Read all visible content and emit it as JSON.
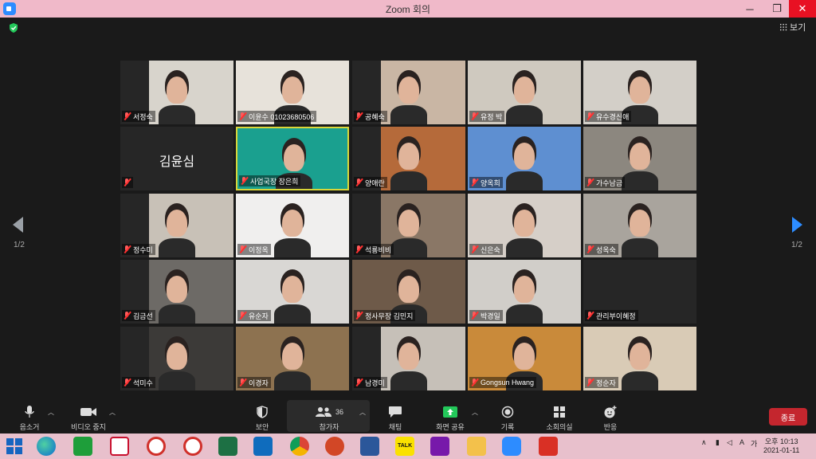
{
  "window": {
    "title": "Zoom 회의",
    "minimize": "─",
    "maximize": "❐",
    "close": "✕"
  },
  "view_button": {
    "label": "보기"
  },
  "pagination": {
    "left": "1/2",
    "right": "1/2"
  },
  "participants": [
    {
      "name": "서정숙",
      "bg": "#d8d4cc"
    },
    {
      "name": "이윤수 01023680506",
      "bg": "#e7e2da"
    },
    {
      "name": "공혜숙",
      "bg": "#c9b6a4"
    },
    {
      "name": "유정 박",
      "bg": "#cfc9bf"
    },
    {
      "name": "유수경신애",
      "bg": "#d3cfc8"
    },
    {
      "name": "김윤심",
      "bg": "#262626"
    },
    {
      "name": "사업국장 장은희",
      "bg": "#1aa08f"
    },
    {
      "name": "양애란",
      "bg": "#b56a3a"
    },
    {
      "name": "양옥희",
      "bg": "#5e8fd1"
    },
    {
      "name": "가수남금",
      "bg": "#8c877f"
    },
    {
      "name": "정수미",
      "bg": "#c8c1b7"
    },
    {
      "name": "이정옥",
      "bg": "#f0efee"
    },
    {
      "name": "석룡비비",
      "bg": "#8a7766"
    },
    {
      "name": "신은숙",
      "bg": "#d6cfc8"
    },
    {
      "name": "성옥숙",
      "bg": "#a9a49d"
    },
    {
      "name": "김금선",
      "bg": "#6d6a66"
    },
    {
      "name": "유순자",
      "bg": "#d9d7d4"
    },
    {
      "name": "정사무장 김민지",
      "bg": "#6e5a49"
    },
    {
      "name": "박경일",
      "bg": "#d1cec9"
    },
    {
      "name": "관리부이혜정",
      "bg": "#262626"
    },
    {
      "name": "석미수",
      "bg": "#3c3a38"
    },
    {
      "name": "이경자",
      "bg": "#8d7250"
    },
    {
      "name": "남경미",
      "bg": "#c6c0b8"
    },
    {
      "name": "Gongsun Hwang",
      "bg": "#c98a3a"
    },
    {
      "name": "정순자",
      "bg": "#d9cbb6"
    }
  ],
  "toolbar": {
    "mute": "음소거",
    "video": "비디오 중지",
    "security": "보안",
    "participants": "참가자",
    "participants_count": "36",
    "chat": "채팅",
    "share": "화면 공유",
    "record": "기록",
    "breakout": "소회의실",
    "reactions": "반응",
    "end": "종료"
  },
  "taskbar": {
    "apps": [
      "Windows",
      "Edge",
      "Store",
      "Zoom Meeting",
      "Sync",
      "Browser",
      "Excel",
      "Outlook",
      "Chrome",
      "PowerPoint",
      "Word",
      "KakaoTalk",
      "OneNote",
      "Explorer",
      "Zoom",
      "Game"
    ],
    "kakao_label": "TALK",
    "ime": "가",
    "clock_time": "오후 10:13",
    "clock_date": "2021-01-11"
  }
}
